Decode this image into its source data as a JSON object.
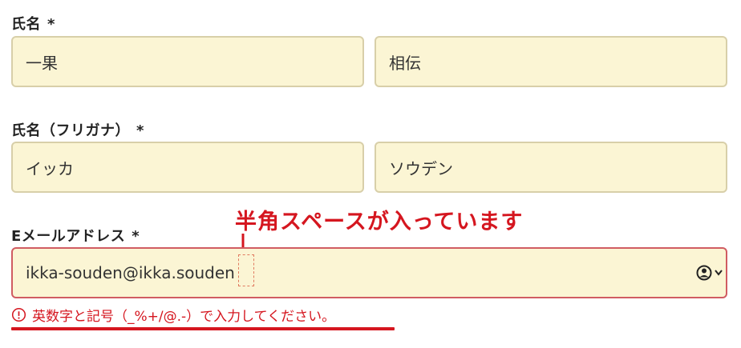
{
  "name_section": {
    "label": "氏名",
    "required_mark": "*",
    "last_name_value": "一果",
    "first_name_value": "相伝"
  },
  "kana_section": {
    "label": "氏名（フリガナ）",
    "required_mark": "*",
    "last_name_value": "イッカ",
    "first_name_value": "ソウデン"
  },
  "email_section": {
    "label": "Eメールアドレス",
    "required_mark": "*",
    "value": "ikka-souden@ikka.souden",
    "annotation": "半角スペースが入っています",
    "error_message": "英数字と記号（_%+/@.-）で入力してください。"
  },
  "colors": {
    "field_bg": "#fbf5d4",
    "field_border": "#d8cfa9",
    "error_border": "#d05c62",
    "accent_red": "#d5161f"
  },
  "icons": {
    "autofill": "person-circle-chevron-icon",
    "error": "exclamation-circle-icon",
    "arrow": "down-arrow-icon"
  }
}
